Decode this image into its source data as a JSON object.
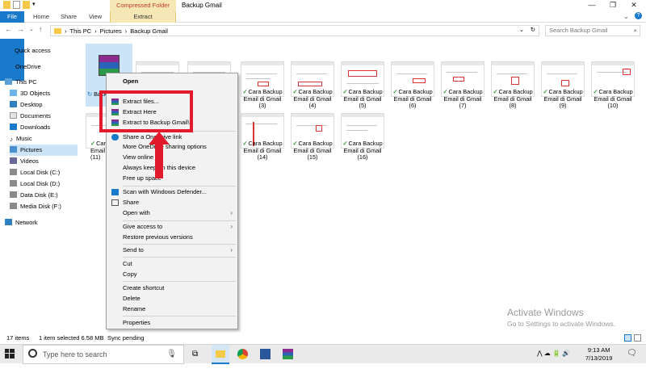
{
  "window": {
    "context_tab_label": "Compressed Folder Tools",
    "title": "Backup Gmail",
    "ribbon_tabs": [
      "File",
      "Home",
      "Share",
      "View",
      "Extract"
    ]
  },
  "address": {
    "path": [
      "This PC",
      "Pictures",
      "Backup Gmail"
    ],
    "search_placeholder": "Search Backup Gmail"
  },
  "sidebar": {
    "items": [
      {
        "label": "Quick access",
        "icon": "star-icon"
      },
      {
        "label": "OneDrive",
        "icon": "cloud-icon"
      },
      {
        "label": "This PC",
        "icon": "computer-icon"
      },
      {
        "label": "3D Objects",
        "icon": "cube-icon"
      },
      {
        "label": "Desktop",
        "icon": "desktop-icon"
      },
      {
        "label": "Documents",
        "icon": "documents-icon"
      },
      {
        "label": "Downloads",
        "icon": "downloads-icon"
      },
      {
        "label": "Music",
        "icon": "music-icon"
      },
      {
        "label": "Pictures",
        "icon": "pictures-icon"
      },
      {
        "label": "Videos",
        "icon": "videos-icon"
      },
      {
        "label": "Local Disk (C:)",
        "icon": "disk-icon"
      },
      {
        "label": "Local Disk (D:)",
        "icon": "disk-icon"
      },
      {
        "label": "Data Disk (E:)",
        "icon": "disk-icon"
      },
      {
        "label": "Media Disk (F:)",
        "icon": "disk-icon"
      },
      {
        "label": "Network",
        "icon": "network-icon"
      }
    ]
  },
  "files": {
    "rar_label": "Backup Gmail",
    "row1": [
      {
        "l1": "Cara Backup",
        "l2": "Email di Gmail",
        "l3": "(3)"
      },
      {
        "l1": "Cara Backup",
        "l2": "Email di Gmail",
        "l3": "(4)"
      },
      {
        "l1": "Cara Backup",
        "l2": "Email di Gmail",
        "l3": "(5)"
      },
      {
        "l1": "Cara Backup",
        "l2": "Email di Gmail",
        "l3": "(6)"
      },
      {
        "l1": "Cara Backup",
        "l2": "Email di Gmail",
        "l3": "(7)"
      },
      {
        "l1": "Cara Backup",
        "l2": "Email di Gmail",
        "l3": "(8)"
      },
      {
        "l1": "Cara Backup",
        "l2": "Email di Gmail",
        "l3": "(9)"
      },
      {
        "l1": "Cara Backup",
        "l2": "Email di Gmail",
        "l3": "(10)"
      }
    ],
    "row2_first": {
      "l1": "Cara B",
      "l2": "Email d",
      "l3": "(11)"
    },
    "row2": [
      {
        "l1": "Cara Backup",
        "l2": "Email di Gmail",
        "l3": "(14)"
      },
      {
        "l1": "Cara Backup",
        "l2": "Email di Gmail",
        "l3": "(15)"
      },
      {
        "l1": "Cara Backup",
        "l2": "Email di Gmail",
        "l3": "(16)"
      }
    ]
  },
  "menu": {
    "items": [
      {
        "label": "Open",
        "bold": true
      },
      {
        "label": "Extract files...",
        "icon": "winrar-icon"
      },
      {
        "label": "Extract Here",
        "icon": "winrar-icon"
      },
      {
        "label": "Extract to Backup Gmail\\",
        "icon": "winrar-icon"
      },
      {
        "label": "Share a OneDrive link",
        "icon": "cloud-icon"
      },
      {
        "label": "More OneDrive sharing options"
      },
      {
        "label": "View online"
      },
      {
        "label": "Always keep on this device"
      },
      {
        "label": "Free up space"
      },
      {
        "label": "Scan with Windows Defender...",
        "icon": "defender-icon"
      },
      {
        "label": "Share",
        "icon": "share-icon"
      },
      {
        "label": "Open with",
        "submenu": true
      },
      {
        "label": "Give access to",
        "submenu": true
      },
      {
        "label": "Restore previous versions"
      },
      {
        "label": "Send to",
        "submenu": true
      },
      {
        "label": "Cut"
      },
      {
        "label": "Copy"
      },
      {
        "label": "Create shortcut"
      },
      {
        "label": "Delete"
      },
      {
        "label": "Rename"
      },
      {
        "label": "Properties"
      }
    ]
  },
  "status": {
    "count": "17 items",
    "selected": "1 item selected  6.58 MB",
    "sync": "Sync pending"
  },
  "watermark": {
    "title": "Activate Windows",
    "subtitle": "Go to Settings to activate Windows."
  },
  "taskbar": {
    "search_placeholder": "Type here to search",
    "time": "9:13 AM",
    "date": "7/13/2019"
  },
  "colors": {
    "accent": "#1979ca",
    "context_tab_bg": "#f6e7b6",
    "selection": "#cce4f7",
    "highlight_red": "#e11b2c"
  }
}
